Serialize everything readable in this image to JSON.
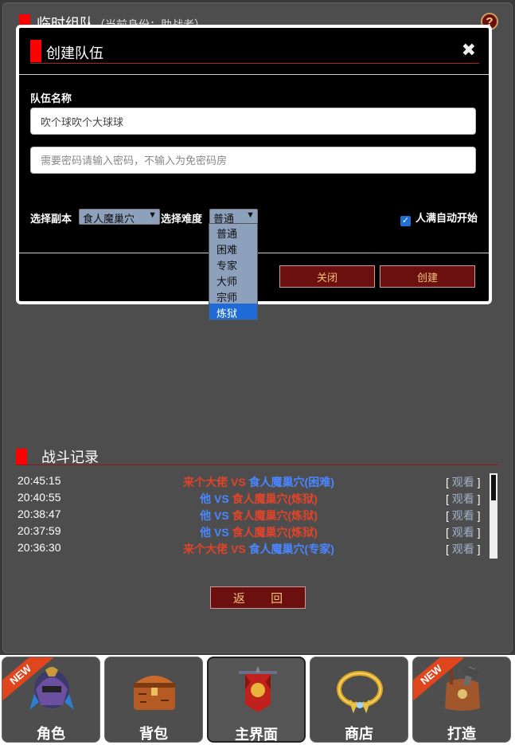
{
  "page": {
    "title": "临时组队",
    "identity": "（当前身份：助战者）",
    "help_icon": "?"
  },
  "modal": {
    "title": "创建队伍",
    "close_icon": "✖",
    "team_name_label": "队伍名称",
    "team_name_value": "吹个球吹个大球球",
    "password_placeholder": "需要密码请输入密码，不输入为免密码房",
    "dungeon_label": "选择副本",
    "dungeon_value": "食人魔巢穴",
    "difficulty_label": "选择难度",
    "difficulty_value": "普通",
    "auto_start_label": "人满自动开始",
    "auto_start_checked": true,
    "close_button": "关闭",
    "create_button": "创建"
  },
  "difficulty_options": [
    "普通",
    "困难",
    "专家",
    "大师",
    "宗师",
    "炼狱"
  ],
  "difficulty_highlighted": "炼狱",
  "battle_log": {
    "title": "战斗记录",
    "rows": [
      {
        "time": "20:45:15",
        "left": "来个大佬",
        "vs": "VS",
        "right": "食人魔巢穴(困难)",
        "left_color": "red",
        "right_color": "blue"
      },
      {
        "time": "20:40:55",
        "left": "他",
        "vs": "VS",
        "right": "食人魔巢穴(炼狱)",
        "left_color": "blue",
        "right_color": "red"
      },
      {
        "time": "20:38:47",
        "left": "他",
        "vs": "VS",
        "right": "食人魔巢穴(炼狱)",
        "left_color": "blue",
        "right_color": "red"
      },
      {
        "time": "20:37:59",
        "left": "他",
        "vs": "VS",
        "right": "食人魔巢穴(炼狱)",
        "left_color": "blue",
        "right_color": "red"
      },
      {
        "time": "20:36:30",
        "left": "来个大佬",
        "vs": "VS",
        "right": "食人魔巢穴(专家)",
        "left_color": "red",
        "right_color": "blue"
      }
    ],
    "watch_label": "观看",
    "bracket_open": "[",
    "bracket_close": "]"
  },
  "back_button": "返 回",
  "bottom_nav": [
    {
      "label": "角色",
      "icon": "helmet-icon",
      "new": true,
      "active": false
    },
    {
      "label": "背包",
      "icon": "chest-icon",
      "new": false,
      "active": false
    },
    {
      "label": "主界面",
      "icon": "banner-icon",
      "new": false,
      "active": true
    },
    {
      "label": "商店",
      "icon": "necklace-icon",
      "new": false,
      "active": false
    },
    {
      "label": "打造",
      "icon": "crafting-bag-icon",
      "new": true,
      "active": false
    }
  ],
  "new_badge": "NEW",
  "colors": {
    "accent_red": "#ff0000",
    "button_bg": "#6b0f0f",
    "button_text": "#f3c27a",
    "link_blue": "#4a86ff",
    "link_red": "#e0442a"
  }
}
